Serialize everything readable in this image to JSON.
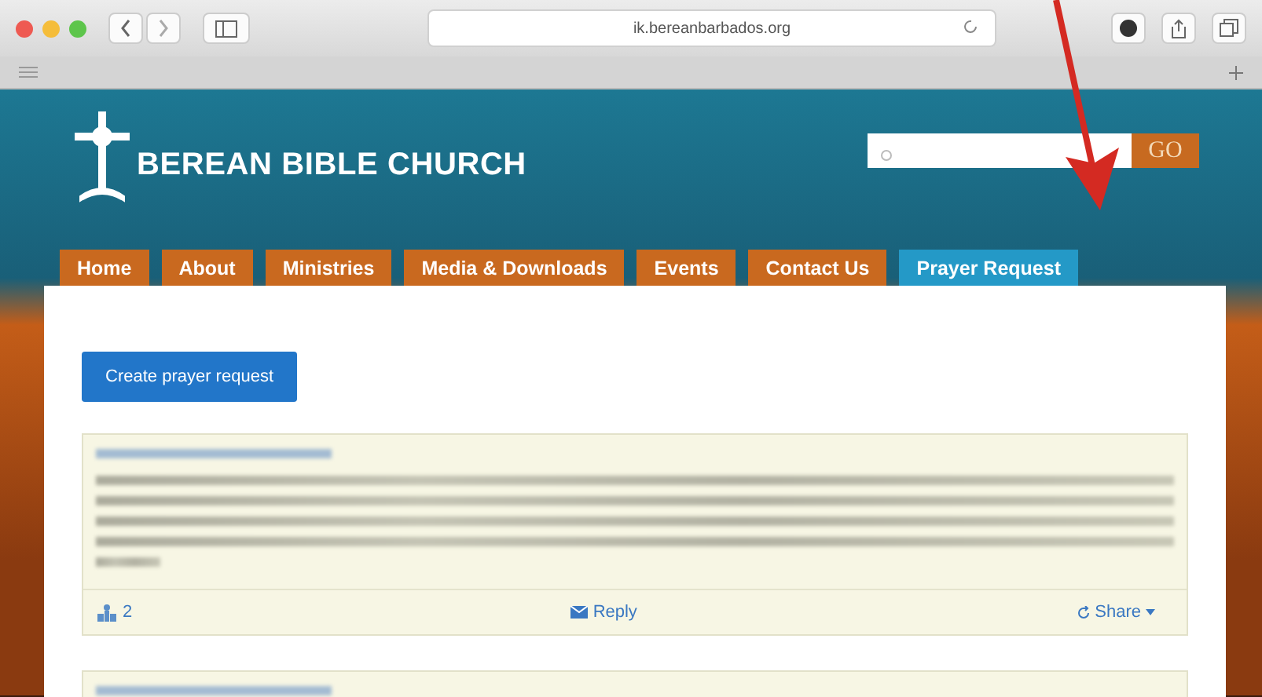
{
  "browser": {
    "url": "ik.bereanbarbados.org"
  },
  "site": {
    "title": "BEREAN BIBLE CHURCH",
    "search_button": "GO"
  },
  "nav": [
    {
      "label": "Home",
      "selected": false
    },
    {
      "label": "About",
      "selected": false
    },
    {
      "label": "Ministries",
      "selected": false
    },
    {
      "label": "Media & Downloads",
      "selected": false
    },
    {
      "label": "Events",
      "selected": false
    },
    {
      "label": "Contact Us",
      "selected": false
    },
    {
      "label": "Prayer Request",
      "selected": true
    }
  ],
  "create_button": "Create prayer request",
  "posts": [
    {
      "kind": "full",
      "footer": {
        "likes": "2",
        "reply": "Reply",
        "share": "Share"
      }
    },
    {
      "kind": "cut-off"
    }
  ]
}
